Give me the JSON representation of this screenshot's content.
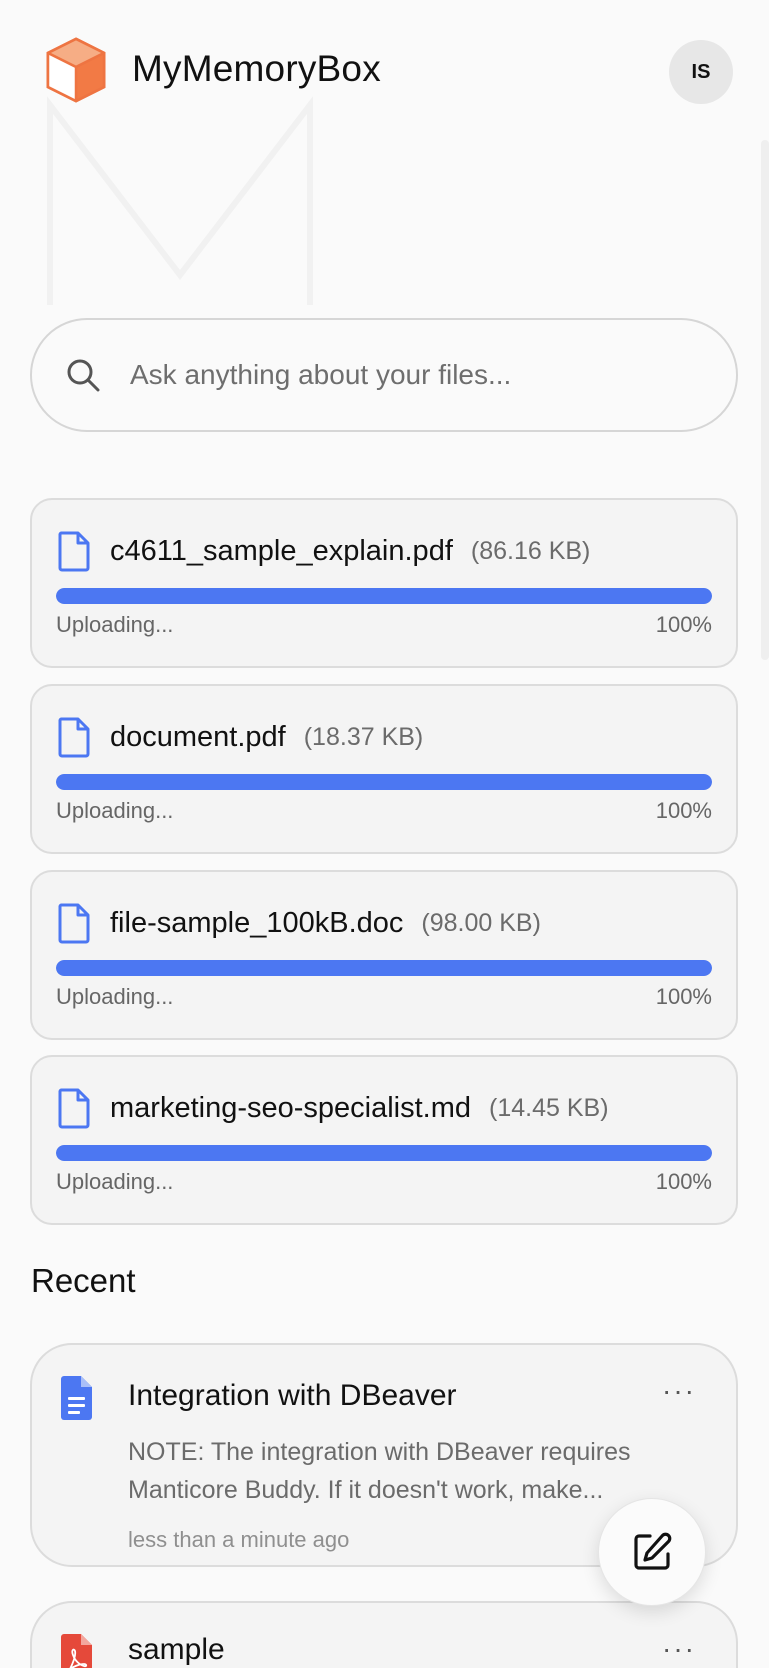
{
  "app": {
    "title": "MyMemoryBox",
    "logo_icon": "box-icon",
    "accent_color": "#4c77f2",
    "logo_color": "#f27a45"
  },
  "user": {
    "initials": "IS"
  },
  "search": {
    "placeholder": "Ask anything about your files..."
  },
  "uploads": [
    {
      "name": "c4611_sample_explain.pdf",
      "size": "(86.16 KB)",
      "status": "Uploading...",
      "percent": "100%",
      "progress": 1.0
    },
    {
      "name": "document.pdf",
      "size": "(18.37 KB)",
      "status": "Uploading...",
      "percent": "100%",
      "progress": 1.0
    },
    {
      "name": "file-sample_100kB.doc",
      "size": "(98.00 KB)",
      "status": "Uploading...",
      "percent": "100%",
      "progress": 1.0
    },
    {
      "name": "marketing-seo-specialist.md",
      "size": "(14.45 KB)",
      "status": "Uploading...",
      "percent": "100%",
      "progress": 1.0
    }
  ],
  "recent": {
    "title": "Recent",
    "items": [
      {
        "title": "Integration with DBeaver",
        "description_line1": "NOTE: The integration with DBeaver requires",
        "description_line2": "Manticore Buddy. If it doesn't work, make...",
        "time": "less than a minute ago",
        "icon": "doc-icon",
        "more": "···"
      },
      {
        "title": "sample",
        "icon": "pdf-icon",
        "more": "···"
      }
    ]
  },
  "fab": {
    "icon": "edit-icon"
  }
}
